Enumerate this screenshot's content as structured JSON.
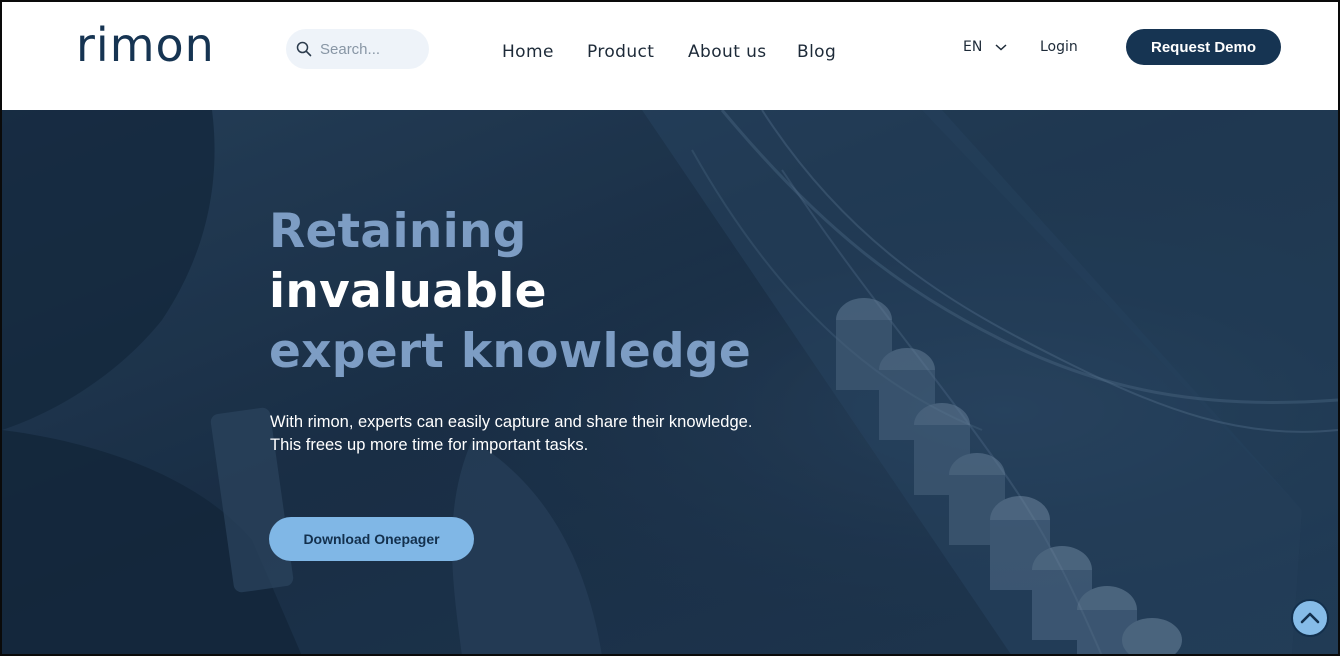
{
  "brand": {
    "logo_text": "rimon",
    "navy": "#163452",
    "accent_light": "#80b7e6"
  },
  "header": {
    "search": {
      "placeholder": "Search...",
      "value": "",
      "icon": "search-icon"
    },
    "nav": [
      {
        "label": "Home"
      },
      {
        "label": "Product"
      },
      {
        "label": "About us"
      },
      {
        "label": "Blog"
      }
    ],
    "language": {
      "selected": "EN",
      "icon": "chevron-down-icon"
    },
    "login_label": "Login",
    "request_demo_label": "Request Demo"
  },
  "hero": {
    "headline": {
      "line1": "Retaining",
      "line2": "invaluable",
      "line3": "expert knowledge"
    },
    "subtext": {
      "line1": "With rimon, experts can easily capture and share their knowledge.",
      "line2": "This frees up more time for important tasks."
    },
    "cta_label": "Download Onepager",
    "scroll_top_icon": "chevron-up-icon"
  }
}
